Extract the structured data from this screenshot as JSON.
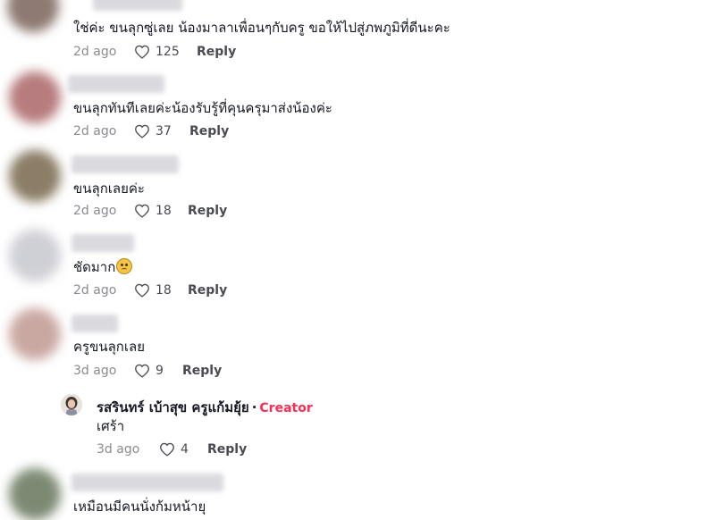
{
  "comments": [
    {
      "text": "ใช่ค่ะ ขนลุกซู่เลย น้องมาลาเพื่อนๆกับครู ขอให้ไปสู่ภพภูมิที่ดีนะคะ",
      "time": "2d ago",
      "likes": "125",
      "reply": "Reply",
      "avatar_color": "#8e7a72"
    },
    {
      "text": "ขนลุกทันทีเลยค่ะน้องรับรู้ที่คุนครุมาส่งน้องค่ะ",
      "time": "2d ago",
      "likes": "37",
      "reply": "Reply",
      "avatar_color": "#b77c7e"
    },
    {
      "text": "ขนลุกเลยค่ะ",
      "time": "2d ago",
      "likes": "18",
      "reply": "Reply",
      "avatar_color": "#8b7d66"
    },
    {
      "text": "ชัดมาก",
      "time": "2d ago",
      "likes": "18",
      "reply": "Reply",
      "avatar_color": "#cfcfd6",
      "emoji": "worried-face"
    },
    {
      "text": "ครูขนลุกเลย",
      "time": "3d ago",
      "likes": "9",
      "reply": "Reply",
      "avatar_color": "#caa8a2"
    }
  ],
  "creator_reply": {
    "name": "รสรินทร์ เบ้าสุข ครูแก้มยุ้ย",
    "separator": "·",
    "badge": "Creator",
    "text": "เศร้า",
    "time": "3d ago",
    "likes": "4",
    "reply": "Reply"
  },
  "last_comment": {
    "text": "เหมือนมีคนนั่งก้มหน้ายุ",
    "avatar_color": "#7d8a73"
  },
  "colors": {
    "creator_badge": "#fe2c55",
    "meta_gray": "#8a8b91"
  }
}
